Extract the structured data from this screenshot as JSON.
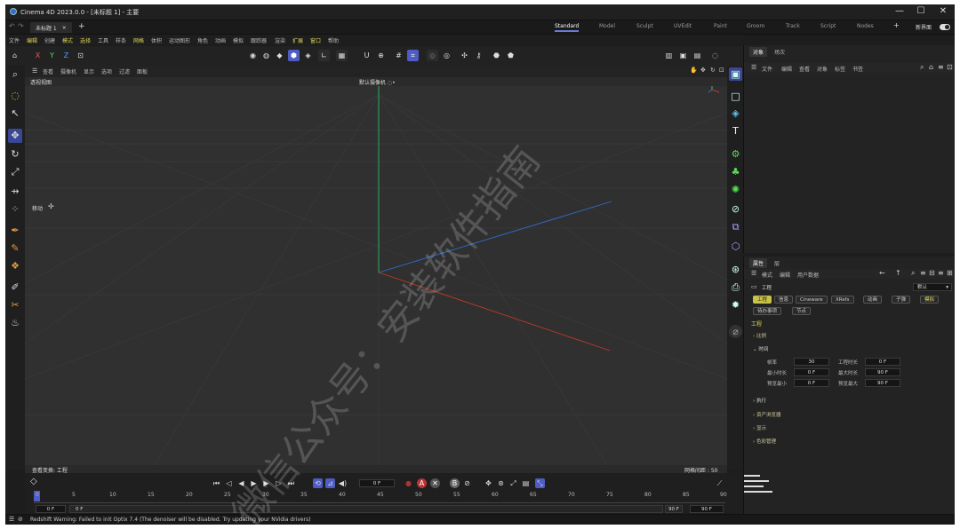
{
  "title": {
    "app": "Cinema 4D 2023.0.0 - [未标题 1] - 主要"
  },
  "window_controls": {
    "minimize": "—",
    "maximize": "☐",
    "close": "✕"
  },
  "doc_tab": {
    "label": "未标题 1",
    "close": "×",
    "add": "+"
  },
  "layouts": [
    "Standard",
    "Model",
    "Sculpt",
    "UVEdit",
    "Paint",
    "Groom",
    "Track",
    "Script",
    "Nodes"
  ],
  "layout_add": "+",
  "new_interface": "新界面",
  "menu": [
    "文件",
    "编辑",
    "创建",
    "模式",
    "选择",
    "工具",
    "样条",
    "网格",
    "体积",
    "运动图形",
    "角色",
    "动画",
    "模拟",
    "跟踪器",
    "渲染",
    "扩展",
    "窗口",
    "帮助"
  ],
  "viewport_menu": [
    "查看",
    "摄像机",
    "显示",
    "选项",
    "过滤",
    "面板"
  ],
  "viewport": {
    "name": "透视视图",
    "camera": "默认摄像机 ◌•",
    "move_label": "移动",
    "footer_left": "查看变换: 工程",
    "grid_spacing": "网格间距 : 50 cm"
  },
  "object_panel": {
    "tabs": [
      "对象",
      "场次"
    ],
    "menu": [
      "文件",
      "编辑",
      "查看",
      "对象",
      "标签",
      "书签"
    ]
  },
  "attr_panel": {
    "tabs": [
      "属性",
      "层"
    ],
    "menu": [
      "模式",
      "编辑",
      "用户数据"
    ],
    "mode": "工程",
    "preset": "默认",
    "chips": [
      "工程",
      "信息",
      "Cineware",
      "XRefs",
      "动画",
      "子弹",
      "模拟",
      "待办事项",
      "节点"
    ],
    "section": "工程",
    "groups": {
      "scale": "比例",
      "time": "时间",
      "exec": "执行",
      "asset": "资产浏览器",
      "display": "显示",
      "color": "色彩管理"
    },
    "fields": {
      "fps_label": "帧率",
      "fps": "30",
      "doc_len_label": "工程时长",
      "doc_len": "0 F",
      "min_time_label": "最小时长",
      "min_time": "0 F",
      "max_time_label": "最大时长",
      "max_time": "90 F",
      "prev_min_label": "预览最小",
      "prev_min": "0 F",
      "prev_max_label": "预览最大",
      "prev_max": "90 F"
    }
  },
  "timeline": {
    "current_frame": "0 F",
    "ruler": [
      "0",
      "5",
      "10",
      "15",
      "20",
      "25",
      "30",
      "35",
      "40",
      "45",
      "50",
      "55",
      "60",
      "65",
      "70",
      "75",
      "80",
      "85",
      "90"
    ],
    "start": "0 F",
    "start2": "0 F",
    "end": "90 F",
    "end2": "90 F"
  },
  "status": "Redshift Warning: Failed to init Optix 7.4 (The denoiser will be disabled. Try updating your NVidia drivers)",
  "watermark": "微信公众号：安装软件指南",
  "colors": {
    "accent": "#4e5cc3",
    "highlight": "#dcd55a",
    "axis_x": "#c0392b",
    "axis_y": "#2ecc71",
    "axis_z": "#2f6fd1"
  }
}
